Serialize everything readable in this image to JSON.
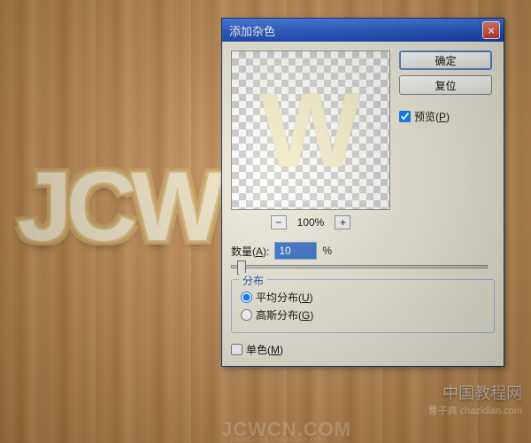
{
  "background_text": "JCW",
  "watermark": {
    "line1": "中国教程网",
    "line2": "曹子典 chazidian.com",
    "line3": "JCWCN.COM",
    "line4": "jiaocheng.chazidian.com"
  },
  "dialog": {
    "title": "添加杂色",
    "close_icon": "×",
    "buttons": {
      "ok": "确定",
      "cancel": "复位"
    },
    "preview_checkbox": {
      "checked": true,
      "label": "预览(P)",
      "underline": "P"
    },
    "zoom": {
      "minus": "−",
      "percent": "100%",
      "plus": "+"
    },
    "amount": {
      "label_prefix": "数量(",
      "underline": "A",
      "label_suffix": "):",
      "value": "10",
      "unit": "%",
      "slider_pos_percent": 2
    },
    "distribution": {
      "legend": "分布",
      "options": [
        {
          "label": "平均分布(U)",
          "underline": "U",
          "checked": true
        },
        {
          "label": "高斯分布(G)",
          "underline": "G",
          "checked": false
        }
      ]
    },
    "monochrome": {
      "label": "单色(M)",
      "underline": "M",
      "checked": false
    }
  }
}
